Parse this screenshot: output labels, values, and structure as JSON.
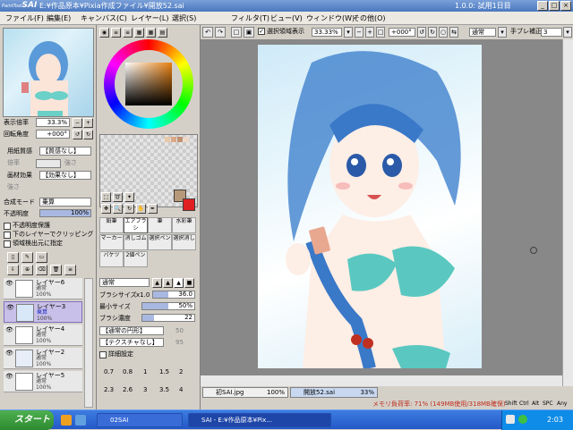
{
  "app": {
    "logo": "SAI",
    "logo_small": "PaintTool",
    "title": "E:¥作品原本¥Pixia作成ファイル¥開放52.sai",
    "version": "1.0.0: 試用1日目"
  },
  "window_buttons": [
    "_",
    "□",
    "×"
  ],
  "menu": [
    "ファイル(F)",
    "編集(E)",
    "キャンバス(C)",
    "レイヤー(L)",
    "選択(S)",
    "フィルタ(T)",
    "ビュー(V)",
    "ウィンドウ(W)",
    "その他(O)"
  ],
  "toolbar": {
    "selection_label": "選択領域表示",
    "zoom": "33.33%",
    "rotation": "+000°",
    "blend_mode": "通常",
    "stabilizer_label": "手ブレ補正",
    "stabilizer_value": "3"
  },
  "navigator": {
    "zoom_label": "表示倍率",
    "zoom_value": "33.3%",
    "rotation_label": "回転角度",
    "rotation_value": "+000°"
  },
  "paper": {
    "texture_label": "用紙質感",
    "texture_value": "【質感なし】",
    "texture_sub1": "倍率",
    "texture_sub2": "強さ",
    "effect_label": "画材効果",
    "effect_value": "【効果なし】",
    "effect_sub1": "強さ"
  },
  "layer_props": {
    "mode_label": "合成モード",
    "mode_value": "乗算",
    "opacity_label": "不透明度",
    "opacity_value": "100%",
    "opacity_fraction": 1.0,
    "options": [
      "不透明度保護",
      "下のレイヤーでクリッピング",
      "領域検出元に指定"
    ]
  },
  "layers": [
    {
      "name": "レイヤー6",
      "mode": "通常",
      "opacity": "100%",
      "selected": false
    },
    {
      "name": "レイヤー3",
      "mode": "乗算",
      "opacity": "100%",
      "selected": true
    },
    {
      "name": "レイヤー4",
      "mode": "通常",
      "opacity": "100%",
      "selected": false
    },
    {
      "name": "レイヤー2",
      "mode": "通常",
      "opacity": "100%",
      "selected": false
    },
    {
      "name": "レイヤー5",
      "mode": "通常",
      "opacity": "100%",
      "selected": false
    }
  ],
  "tools": [
    {
      "label": "鉛筆",
      "on": false
    },
    {
      "label": "エアブラシ",
      "on": true
    },
    {
      "label": "筆",
      "on": false
    },
    {
      "label": "水彩筆",
      "on": false
    },
    {
      "label": "マーカー",
      "on": false
    },
    {
      "label": "消しゴム",
      "on": false
    },
    {
      "label": "選択ペン",
      "on": false
    },
    {
      "label": "選択消し",
      "on": false
    },
    {
      "label": "バケツ",
      "on": false
    },
    {
      "label": "2値ペン",
      "on": false
    }
  ],
  "brush": {
    "mode": "通常",
    "size_label": "ブラシサイズ",
    "size_mult": "x1.0",
    "size_value": "36.0",
    "size_fraction": 0.36,
    "min_label": "最小サイズ",
    "min_value": "50%",
    "min_fraction": 0.5,
    "density_label": "ブラシ濃度",
    "density_value": "22",
    "density_fraction": 0.22,
    "shape": "【通常の円形】",
    "shape_value": "50",
    "texture": "【テクスチャなし】",
    "texture_value": "95",
    "detail_label": "詳細設定"
  },
  "brush_sizes_row1": [
    "0.7",
    "0.8",
    "1",
    "1.5",
    "2"
  ],
  "brush_sizes_row2": [
    "2.3",
    "2.6",
    "3",
    "3.5",
    "4"
  ],
  "doc_tabs": [
    {
      "name": "初SAI.jpg",
      "zoom": "100%",
      "selected": false
    },
    {
      "name": "開放52.sai",
      "zoom": "33%",
      "selected": true
    }
  ],
  "status": {
    "memory": "メモリ負荷率: 71% (149MB使用/318MB確保)",
    "keys": [
      "Shift",
      "Ctrl",
      "Alt",
      "SPC"
    ],
    "any": "Any"
  },
  "taskbar": {
    "start": "スタート",
    "items": [
      {
        "label": "02SAI",
        "active": false
      },
      {
        "label": "SAI - E:¥作品原本¥Pix...",
        "active": true
      }
    ],
    "time": "2:03"
  },
  "colors": {
    "primary": "#b89878",
    "secondary": "#e02020",
    "accent": "#316ac5"
  }
}
